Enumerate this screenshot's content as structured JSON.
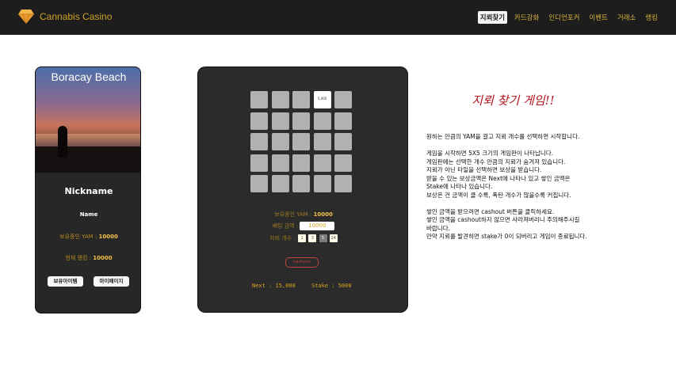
{
  "header": {
    "brand_name": "Cannabis Casino",
    "brand_icon": "diamond-icon",
    "nav": [
      "지뢰찾기",
      "카드강화",
      "인디언포커",
      "이벤트",
      "거래소",
      "랭킹"
    ],
    "active_nav": "지뢰찾기",
    "colors": {
      "bar": "#1d1d1d",
      "accent": "#d9b43a"
    }
  },
  "profile": {
    "photo_caption": "Boracay Beach",
    "nickname": "Nickname",
    "name": "Name",
    "yam_label": "보유중인 YAM :",
    "yam_value": "10000",
    "rank_label": "현재 랭킹 :",
    "rank_value": "10000",
    "items_button": "보유아이템",
    "mypage_button": "마이페이지"
  },
  "game": {
    "grid_size": 5,
    "revealed_tile_value": "5,000",
    "yam_label": "보유중인 YAM :",
    "yam_value": "10000",
    "bet_label": "배팅 금액 :",
    "bet_value": "10000",
    "mines_label": "지뢰 개수 :",
    "mine_options": [
      "1",
      "3",
      "5",
      "24"
    ],
    "mine_selected": "5",
    "cashout_label": "cashout",
    "next_label": "Next : 15,000",
    "stake_label": "Stake : 5000"
  },
  "rules": {
    "title": "지뢰 찾기 게임!!",
    "intro": "원하는 만큼의 YAM을 걸고 지뢰 개수를 선택하면 시작합니다.",
    "p1": [
      "게임을 시작하면 5X5 크기의 게임판이 나타납니다.",
      "게임판에는 선택한 개수 만큼의 지뢰가 숨겨져 있습니다.",
      "지뢰가 아닌 타일을 선택하면 보상을 받습니다.",
      "받을 수 있는 보상금액은 Next에 나타나 있고 쌓인 금액은",
      "Stake에 나타나 있습니다.",
      "보상은 건 금액이 클 수록, 폭탄 개수가 많을수록 커집니다."
    ],
    "p2": [
      "쌓인 금액을 받으려면 cashout 버튼을 클릭하세요.",
      "쌓인 금액을 cashout하지 않으면 사라져버리니 주의해주시길",
      "바랍니다.",
      "만약 지뢰를 발견하면 stake가 0이 되버리고 게임이 종료됩니다."
    ]
  }
}
